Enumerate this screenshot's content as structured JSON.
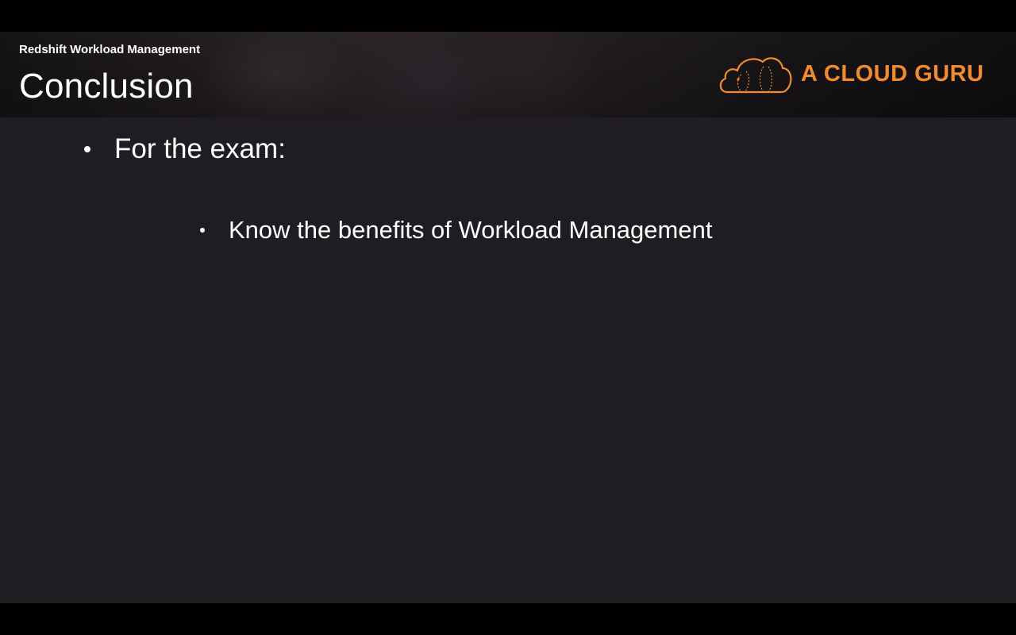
{
  "header": {
    "course_title": "Redshift Workload Management",
    "slide_title": "Conclusion",
    "logo": {
      "icon": "cloud-logo-icon",
      "text": "A CLOUD GURU",
      "color": "#f28a2e"
    }
  },
  "content": {
    "bullets": [
      {
        "label": "For the exam:"
      },
      {
        "label": "Know the benefits of Workload Management"
      }
    ]
  },
  "colors": {
    "slide_background": "#1f1d21",
    "letterbox": "#000000",
    "text": "#ffffff",
    "brand": "#f28a2e"
  }
}
